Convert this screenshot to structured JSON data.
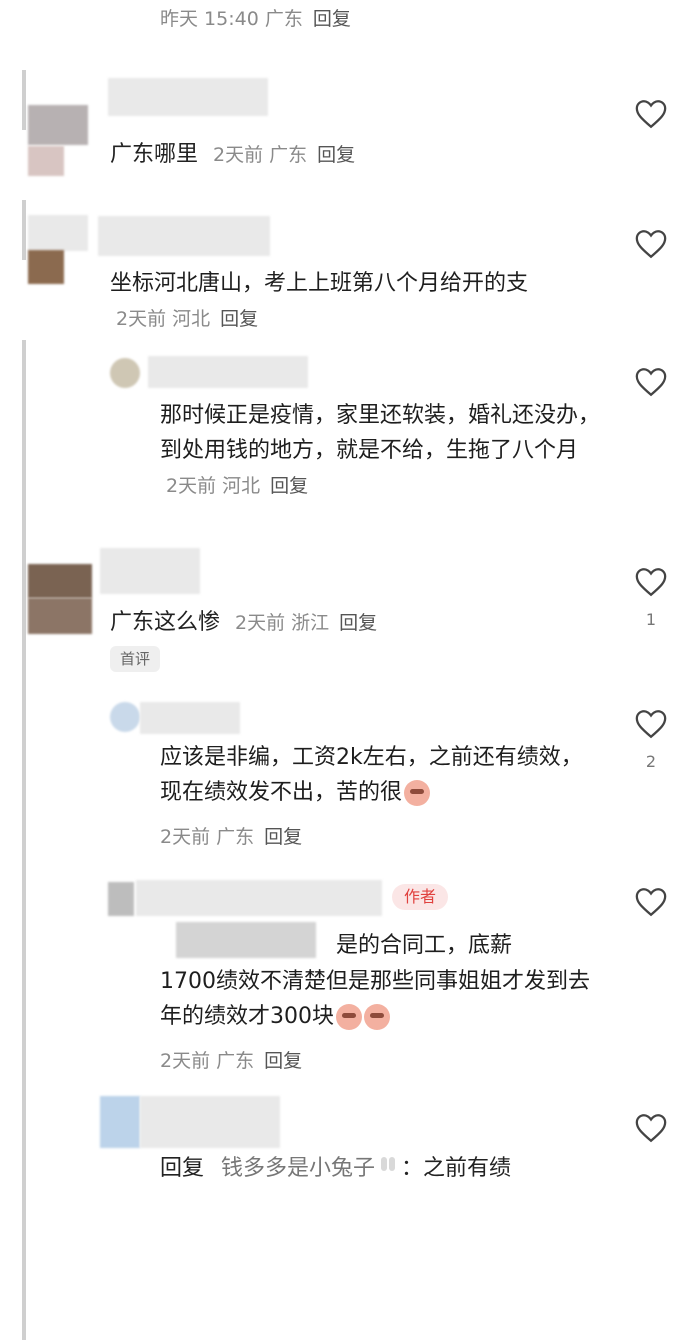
{
  "top": {
    "meta": "昨天 15:40 广东",
    "reply": "回复"
  },
  "comments": [
    {
      "text": "广东哪里",
      "time": "2天前",
      "loc": "广东",
      "reply": "回复"
    },
    {
      "text": "坐标河北唐山，考上上班第八个月给开的支",
      "time": "2天前",
      "loc": "河北",
      "reply": "回复"
    },
    {
      "text": "那时候正是疫情，家里还软装，婚礼还没办，到处用钱的地方，就是不给，生拖了八个月",
      "time": "2天前",
      "loc": "河北",
      "reply": "回复"
    },
    {
      "text": "广东这么惨",
      "time": "2天前",
      "loc": "浙江",
      "reply": "回复",
      "likes": "1",
      "tag": "首评"
    },
    {
      "text": "应该是非编，工资2k左右，之前还有绩效，现在绩效发不出，苦的很",
      "time": "2天前",
      "loc": "广东",
      "reply": "回复",
      "likes": "2"
    },
    {
      "tag": "作者",
      "text_lead": "是的合同工，底薪",
      "text": "1700绩效不清楚但是那些同事姐姐才发到去年的绩效才300块",
      "time": "2天前",
      "loc": "广东",
      "reply": "回复"
    },
    {
      "reply_prefix": "回复",
      "reply_to": "钱多多是小兔子",
      "text": "：之前有绩"
    }
  ],
  "icons": {
    "like": "heart-outline-icon",
    "emoji": "crying-face-emoji-icon",
    "bunny": "bunny-emoji-icon"
  },
  "colors": {
    "author_tag": "#e0413e",
    "meta": "#8a8a8a"
  }
}
